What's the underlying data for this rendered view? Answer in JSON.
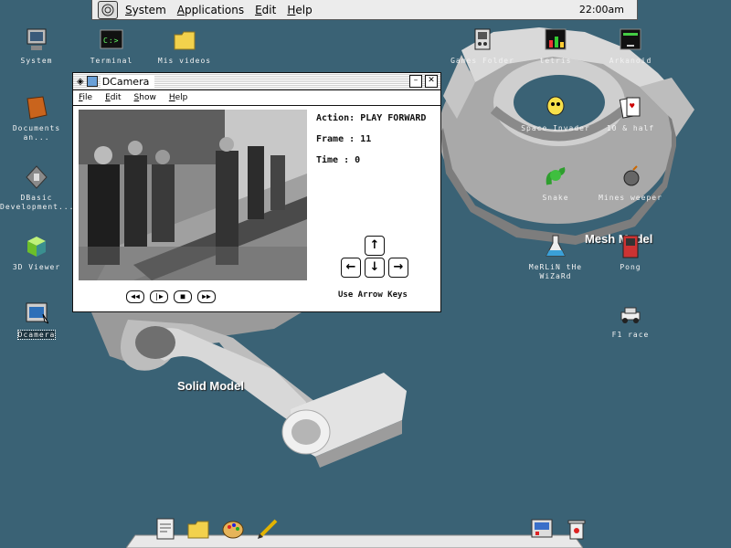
{
  "menubar": {
    "items": [
      "System",
      "Applications",
      "Edit",
      "Help"
    ],
    "clock": "22:00am"
  },
  "desktop_icons": {
    "system": "System",
    "terminal": "Terminal",
    "mis_videos": "Mis videos",
    "documents": "Documents an...",
    "dbasic": "DBasic Development...",
    "viewer3d": "3D Viewer",
    "dcamera": "Dcamera",
    "games_folder": "Games Folder",
    "tetris": "tetris",
    "arkanoid": "Arkanoid",
    "space_invader": "Space Invader",
    "ten_half": "10 & half",
    "snake": "Snake",
    "minesweeper": "Mines weeper",
    "merlin": "MeRLiN tHe WiZaRd",
    "pong": "Pong",
    "f1race": "F1 race"
  },
  "labels": {
    "mesh_model": "Mesh Model",
    "solid_model": "Solid Model"
  },
  "window": {
    "title": "DCamera",
    "menu": [
      "File",
      "Edit",
      "Show",
      "Help"
    ],
    "action_label": "Action:",
    "action_value": "PLAY FORWARD",
    "frame_label": "Frame :",
    "frame_value": "11",
    "time_label": "Time :",
    "time_value": "0",
    "hint": "Use Arrow Keys"
  },
  "colors": {
    "desktop": "#3a6275",
    "menubar": "#ececec"
  }
}
